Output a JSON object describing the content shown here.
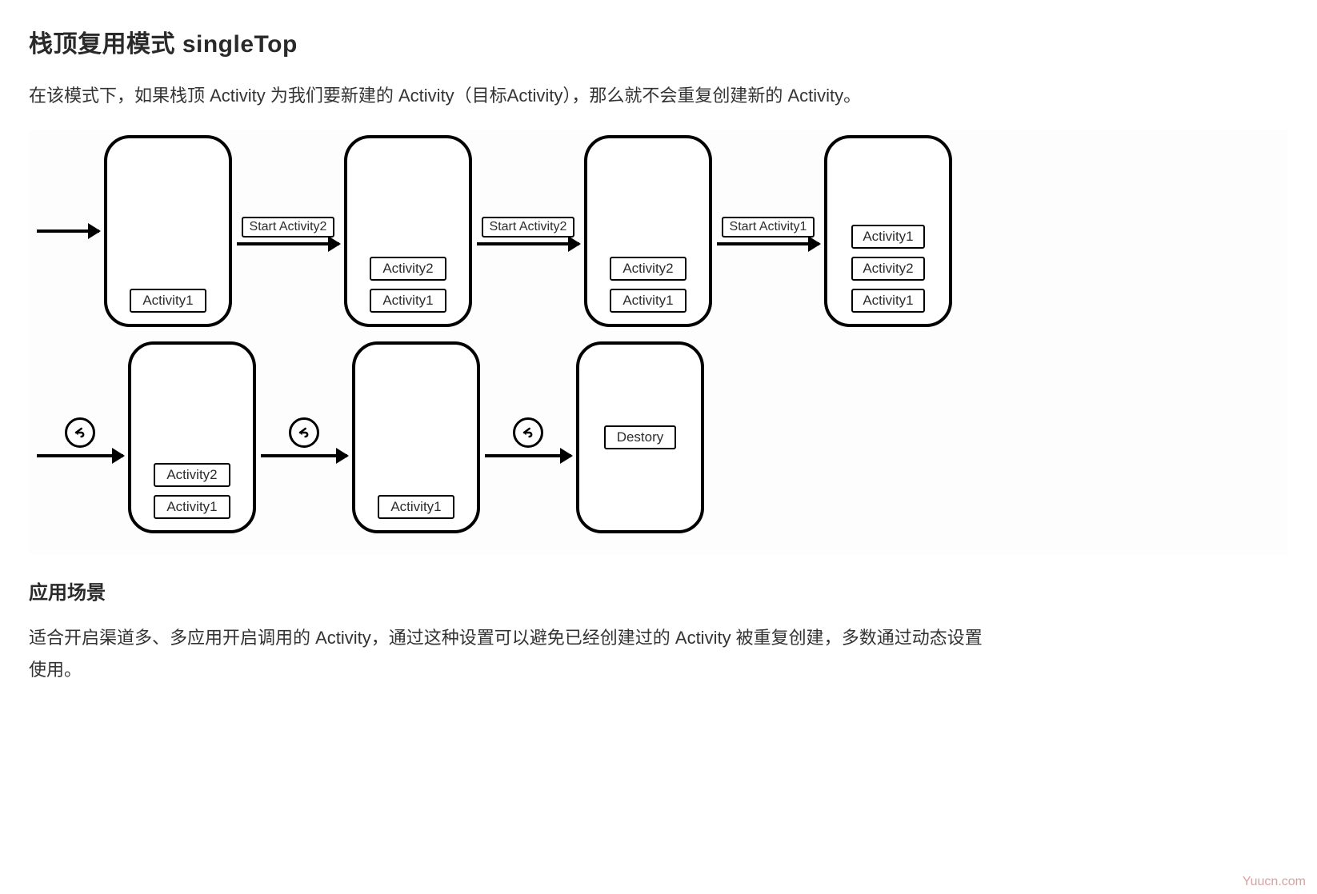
{
  "heading": "栈顶复用模式 singleTop",
  "intro": "在该模式下，如果栈顶 Activity 为我们要新建的 Activity（目标Activity），那么就不会重复创建新的 Activity。",
  "diagram": {
    "row1": {
      "arrows": [
        {
          "label": null
        },
        {
          "label": "Start Activity2"
        },
        {
          "label": "Start Activity2"
        },
        {
          "label": "Start Activity1"
        }
      ],
      "stacks": [
        [
          "Activity1"
        ],
        [
          "Activity1",
          "Activity2"
        ],
        [
          "Activity1",
          "Activity2"
        ],
        [
          "Activity1",
          "Activity2",
          "Activity1"
        ]
      ]
    },
    "row2": {
      "arrows": [
        {
          "back": true
        },
        {
          "back": true
        },
        {
          "back": true
        }
      ],
      "stacks": [
        [
          "Activity1",
          "Activity2"
        ],
        [
          "Activity1"
        ],
        [],
        [
          "Destory"
        ]
      ]
    }
  },
  "subheading": "应用场景",
  "usecase": "适合开启渠道多、多应用开启调用的 Activity，通过这种设置可以避免已经创建过的 Activity 被重复创建，多数通过动态设置使用。",
  "watermark": "Yuucn.com"
}
